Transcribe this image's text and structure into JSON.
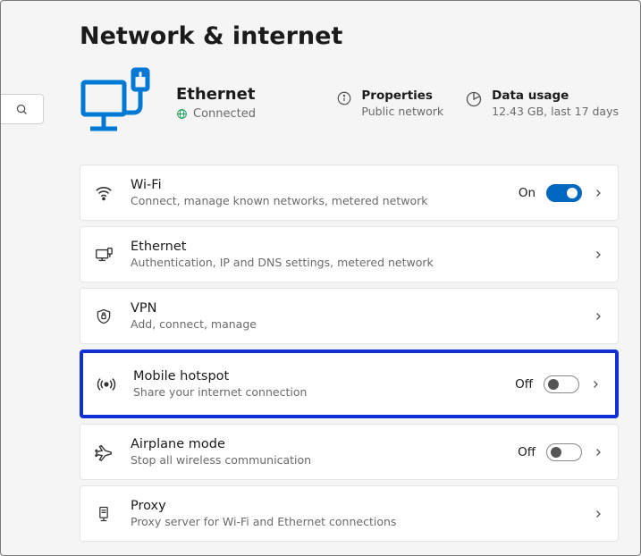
{
  "page_title": "Network & internet",
  "connection": {
    "name": "Ethernet",
    "status": "Connected"
  },
  "info": {
    "properties": {
      "label": "Properties",
      "value": "Public network"
    },
    "data_usage": {
      "label": "Data usage",
      "value": "12.43 GB, last 17 days"
    }
  },
  "cards": {
    "wifi": {
      "title": "Wi-Fi",
      "sub": "Connect, manage known networks, metered network",
      "state": "On",
      "toggle": true
    },
    "ethernet": {
      "title": "Ethernet",
      "sub": "Authentication, IP and DNS settings, metered network"
    },
    "vpn": {
      "title": "VPN",
      "sub": "Add, connect, manage"
    },
    "hotspot": {
      "title": "Mobile hotspot",
      "sub": "Share your internet connection",
      "state": "Off",
      "toggle": false
    },
    "airplane": {
      "title": "Airplane mode",
      "sub": "Stop all wireless communication",
      "state": "Off",
      "toggle": false
    },
    "proxy": {
      "title": "Proxy",
      "sub": "Proxy server for Wi-Fi and Ethernet connections"
    }
  }
}
